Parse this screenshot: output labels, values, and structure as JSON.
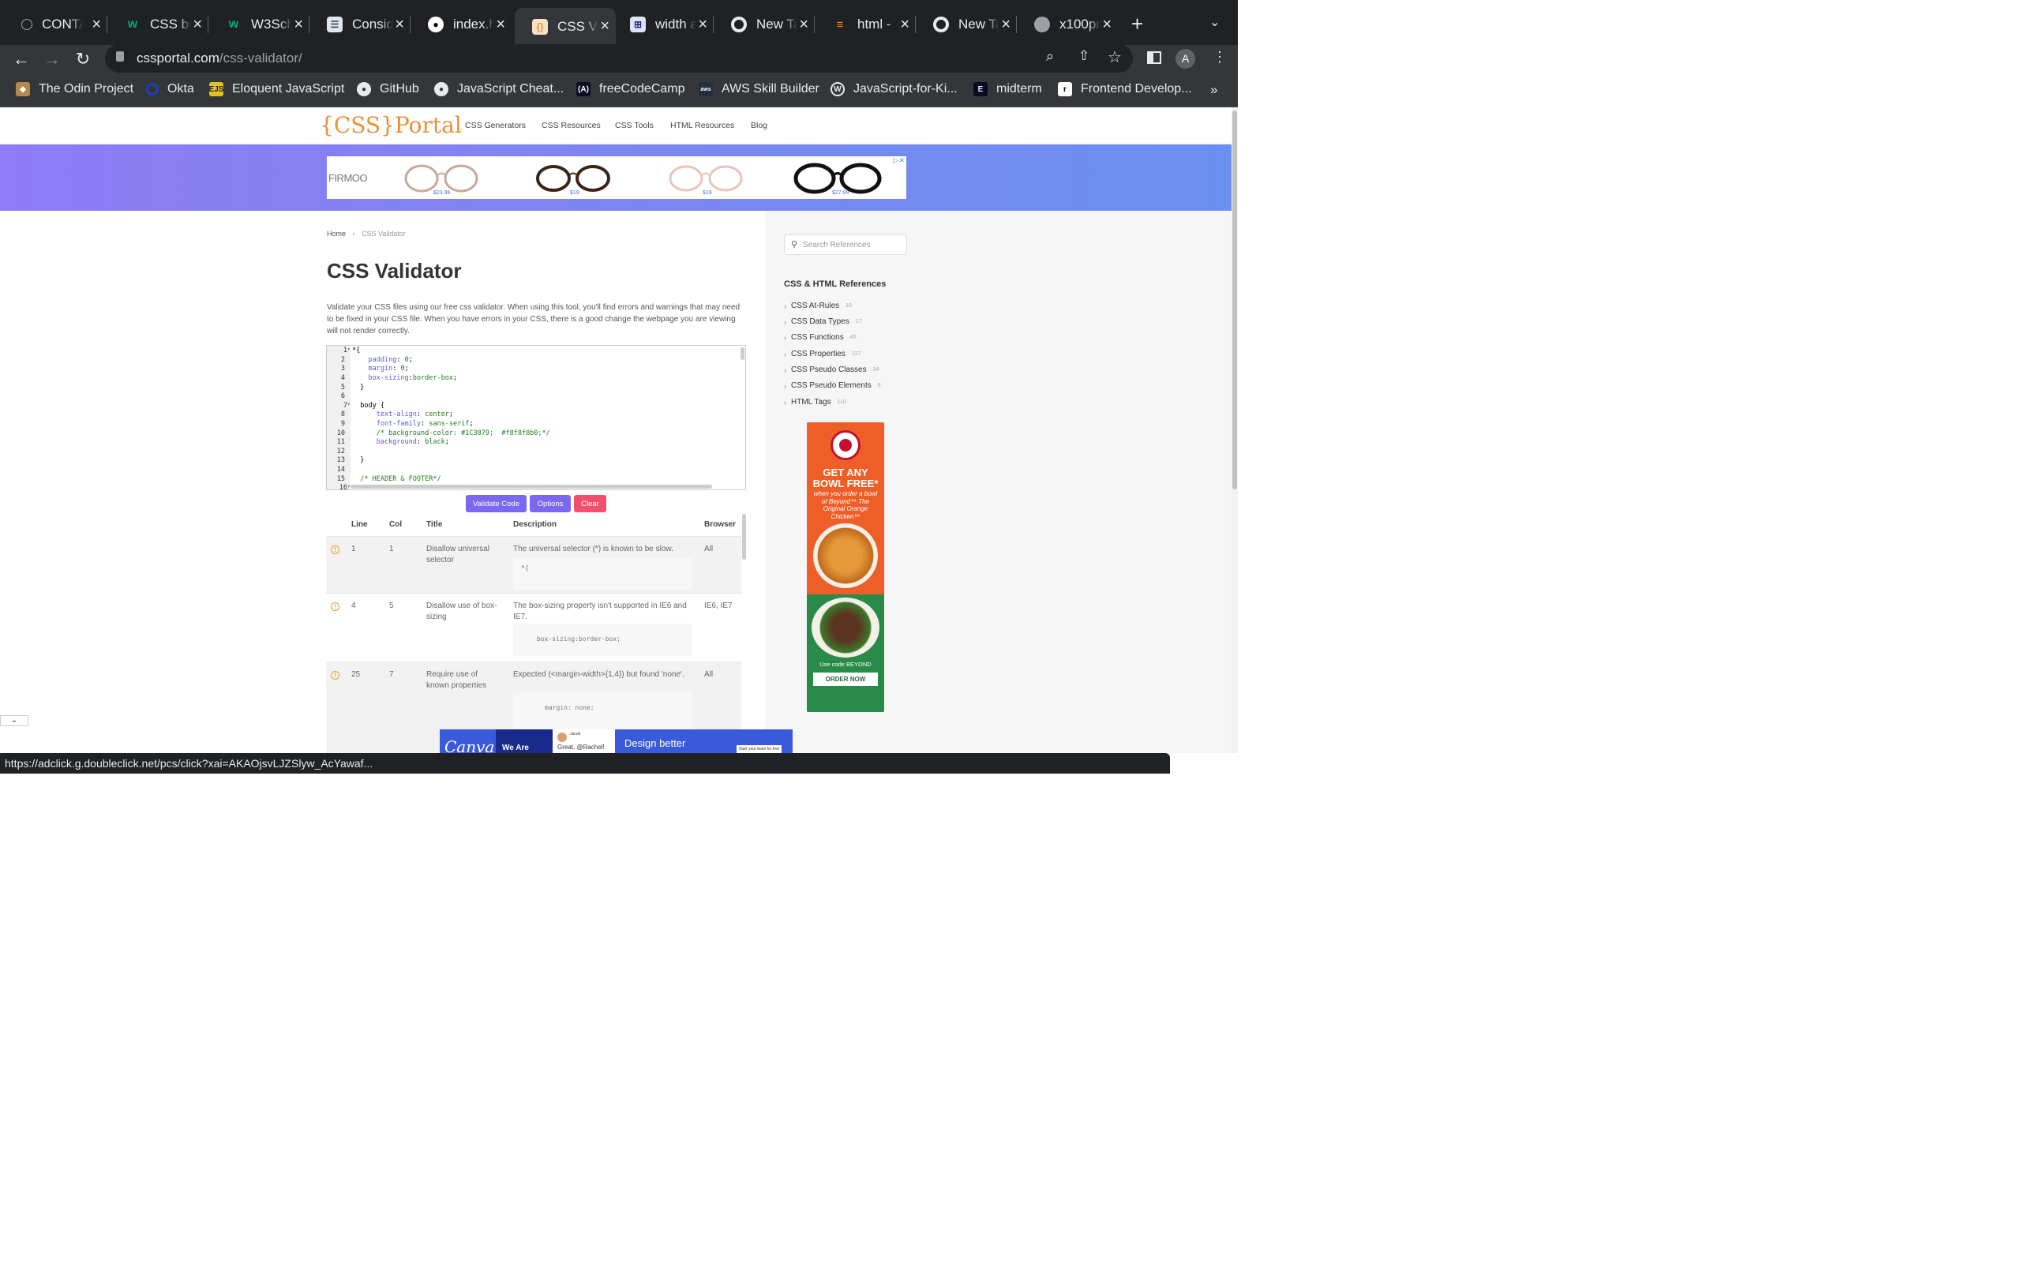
{
  "browser": {
    "tabs": [
      {
        "title": "CONTA",
        "icon": "link-icon"
      },
      {
        "title": "CSS bo",
        "icon": "w3schools-icon"
      },
      {
        "title": "W3Sch",
        "icon": "w3schools-icon"
      },
      {
        "title": "Consid",
        "icon": "document-icon"
      },
      {
        "title": "index.h",
        "icon": "github-icon"
      },
      {
        "title": "CSS Va",
        "icon": "cssportal-icon"
      },
      {
        "title": "width a",
        "icon": "book-icon"
      },
      {
        "title": "New Ta",
        "icon": "chrome-icon"
      },
      {
        "title": "html - ",
        "icon": "stackoverflow-icon"
      },
      {
        "title": "New Ta",
        "icon": "chrome-icon"
      },
      {
        "title": "x100pr",
        "icon": "globe-icon"
      }
    ],
    "url_host": "cssportal.com",
    "url_path": "/css-validator/",
    "profile_initial": "A",
    "bookmarks": [
      "The Odin Project",
      "Okta",
      "Eloquent JavaScript",
      "GitHub",
      "JavaScript Cheat...",
      "freeCodeCamp",
      "AWS Skill Builder",
      "JavaScript-for-Ki...",
      "midterm",
      "Frontend Develop..."
    ],
    "status_url": "https://adclick.g.doubleclick.net/pcs/click?xai=AKAOjsvLJZSlyw_AcYawaf..."
  },
  "site": {
    "logo": "{CSS}Portal",
    "nav": [
      "CSS Generators",
      "CSS Resources",
      "CSS Tools",
      "HTML Resources",
      "Blog"
    ],
    "ad_brand": "FIRMOO",
    "ad_prices": [
      "$23.99",
      "$19",
      "$19",
      "$27.99"
    ]
  },
  "main": {
    "breadcrumb_home": "Home",
    "breadcrumb_sep": "›",
    "breadcrumb_current": "CSS Validator",
    "title": "CSS Validator",
    "intro": "Validate your CSS files using our free css validator. When using this tool, you'll find errors and warnings that may need to be fixed in your CSS file. When you have errors in your CSS, there is a good change the webpage you are viewing will not render correctly.",
    "code_lines": [
      "1",
      "2",
      "3",
      "4",
      "5",
      "6",
      "7",
      "8",
      "9",
      "10",
      "11",
      "12",
      "13",
      "14",
      "15",
      "16"
    ],
    "buttons": {
      "validate": "Validate Code",
      "options": "Options",
      "clear": "Clear"
    },
    "results_headers": {
      "line": "Line",
      "col": "Col",
      "title": "Title",
      "description": "Description",
      "browser": "Browser"
    },
    "results": [
      {
        "line": "1",
        "col": "1",
        "title": "Disallow universal selector",
        "description": "The universal selector (*) is known to be slow.",
        "code": "*{",
        "browser": "All"
      },
      {
        "line": "4",
        "col": "5",
        "title": "Disallow use of box-sizing",
        "description": "The box-sizing property isn't supported in IE6 and IE7.",
        "code": "box-sizing:border-box;",
        "browser": "IE6, IE7"
      },
      {
        "line": "25",
        "col": "7",
        "title": "Require use of known properties",
        "description": "Expected (<margin-width>{1,4}) but found 'none'.",
        "code": "margin: none;",
        "browser": "All"
      }
    ]
  },
  "sidebar": {
    "search_placeholder": "Search References",
    "heading": "CSS & HTML References",
    "items": [
      {
        "label": "CSS At-Rules",
        "count": "10"
      },
      {
        "label": "CSS Data Types",
        "count": "17"
      },
      {
        "label": "CSS Functions",
        "count": "45"
      },
      {
        "label": "CSS Properties",
        "count": "227"
      },
      {
        "label": "CSS Pseudo Classes",
        "count": "34"
      },
      {
        "label": "CSS Pseudo Elements",
        "count": "6"
      },
      {
        "label": "HTML Tags",
        "count": "110"
      }
    ],
    "ad": {
      "brand": "PANDA EXPRESS",
      "headline": "GET ANY BOWL FREE*",
      "sub": "when you order a bowl of Beyond™ The Original Orange Chicken™",
      "code_text": "Use code BEYOND",
      "cta": "ORDER NOW"
    }
  },
  "bottom_ad": {
    "brand": "Canva",
    "we_are": "We Are",
    "name": "Jacob",
    "snippet": "Great, @Rachel!",
    "headline": "Design better",
    "cta": "Start your team for free"
  },
  "colors": {
    "accent_purple": "#7b68ee",
    "clear_red": "#f0506e",
    "logo_orange": "#e8913a"
  }
}
